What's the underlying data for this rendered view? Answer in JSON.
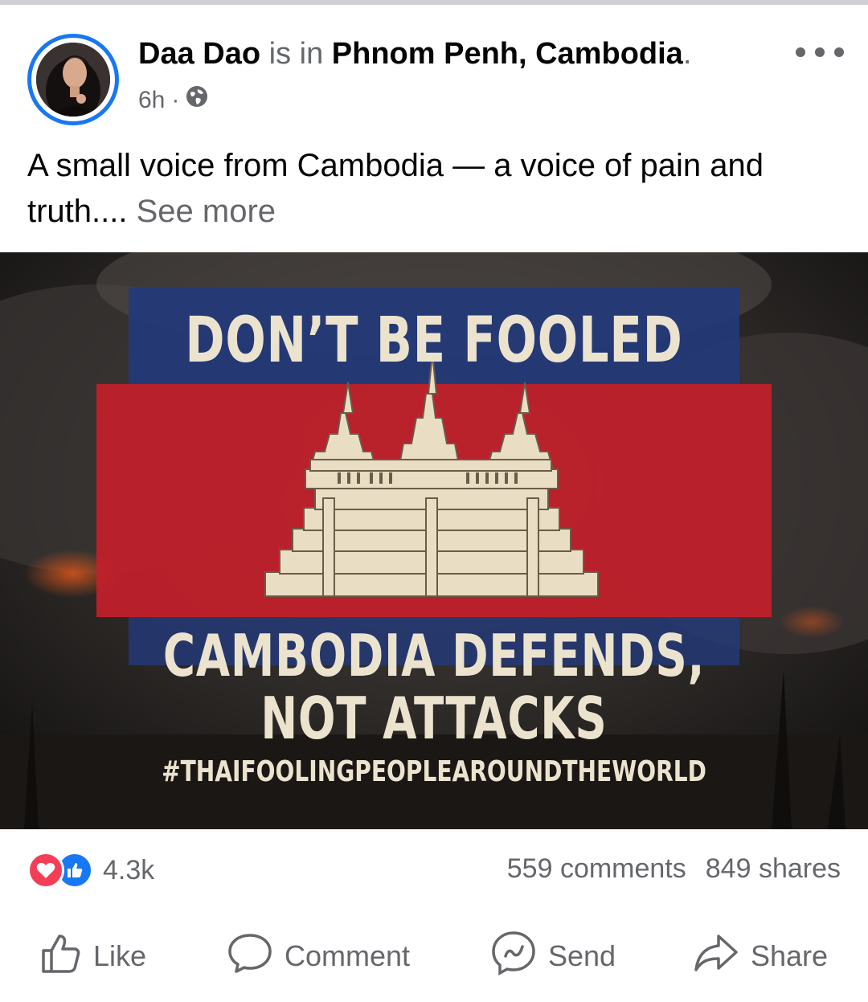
{
  "post": {
    "author": "Daa Dao",
    "is_in": "is in",
    "place": "Phnom Penh, Cambodia",
    "place_suffix": ".",
    "time": "6h",
    "time_separator": "·",
    "audience_icon": "globe-icon",
    "caption": "A small voice from Cambodia — a voice of pain and truth....",
    "see_more": "See more"
  },
  "image": {
    "headline": "DON’T BE FOOLED",
    "subline_1": "CAMBODIA DEFENDS,",
    "subline_2": "NOT ATTACKS",
    "hashtag": "#THAIFOOLINGPEOPLEAROUNDTHEWORLD",
    "colors": {
      "blue": "#233a7a",
      "red": "#c3202a",
      "temple": "#e9ddc4"
    }
  },
  "engagement": {
    "reactions_count": "4.3k",
    "comments": "559 comments",
    "shares": "849 shares"
  },
  "actions": {
    "like": "Like",
    "comment": "Comment",
    "send": "Send",
    "share": "Share"
  },
  "colors": {
    "accent": "#1877f2",
    "love": "#f33e58",
    "muted": "#65676b"
  }
}
